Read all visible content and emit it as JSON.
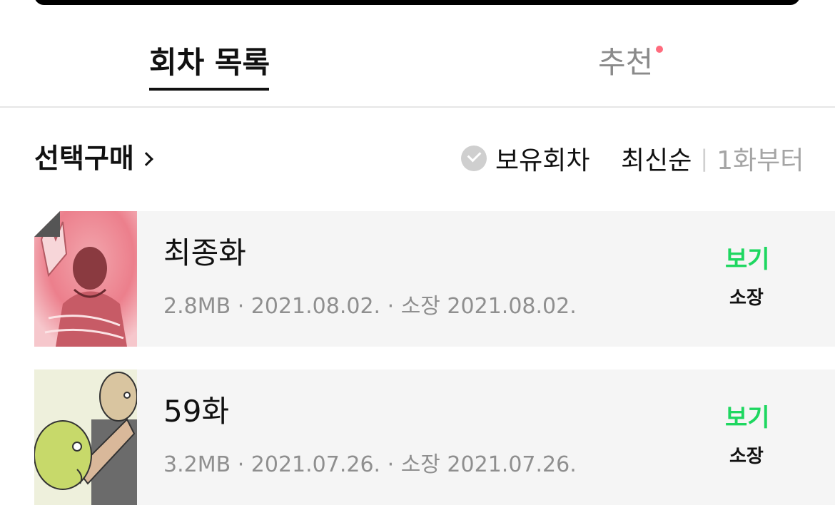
{
  "tabs": {
    "episodes_label": "회차 목록",
    "recommend_label": "추천"
  },
  "filters": {
    "select_buy_label": "선택구매",
    "owned_label": "보유회차",
    "sort_latest_label": "최신순",
    "sort_separator": "|",
    "sort_first_label": "1화부터"
  },
  "episodes": [
    {
      "title": "최종화",
      "meta": "2.8MB · 2021.08.02. · 소장 2021.08.02.",
      "view_label": "보기",
      "owned_label": "소장"
    },
    {
      "title": "59화",
      "meta": "3.2MB · 2021.07.26. · 소장 2021.07.26.",
      "view_label": "보기",
      "owned_label": "소장"
    }
  ],
  "colors": {
    "accent_green": "#1ed760",
    "notification_dot": "#ff6b7d",
    "row_background": "#f5f5f5"
  }
}
